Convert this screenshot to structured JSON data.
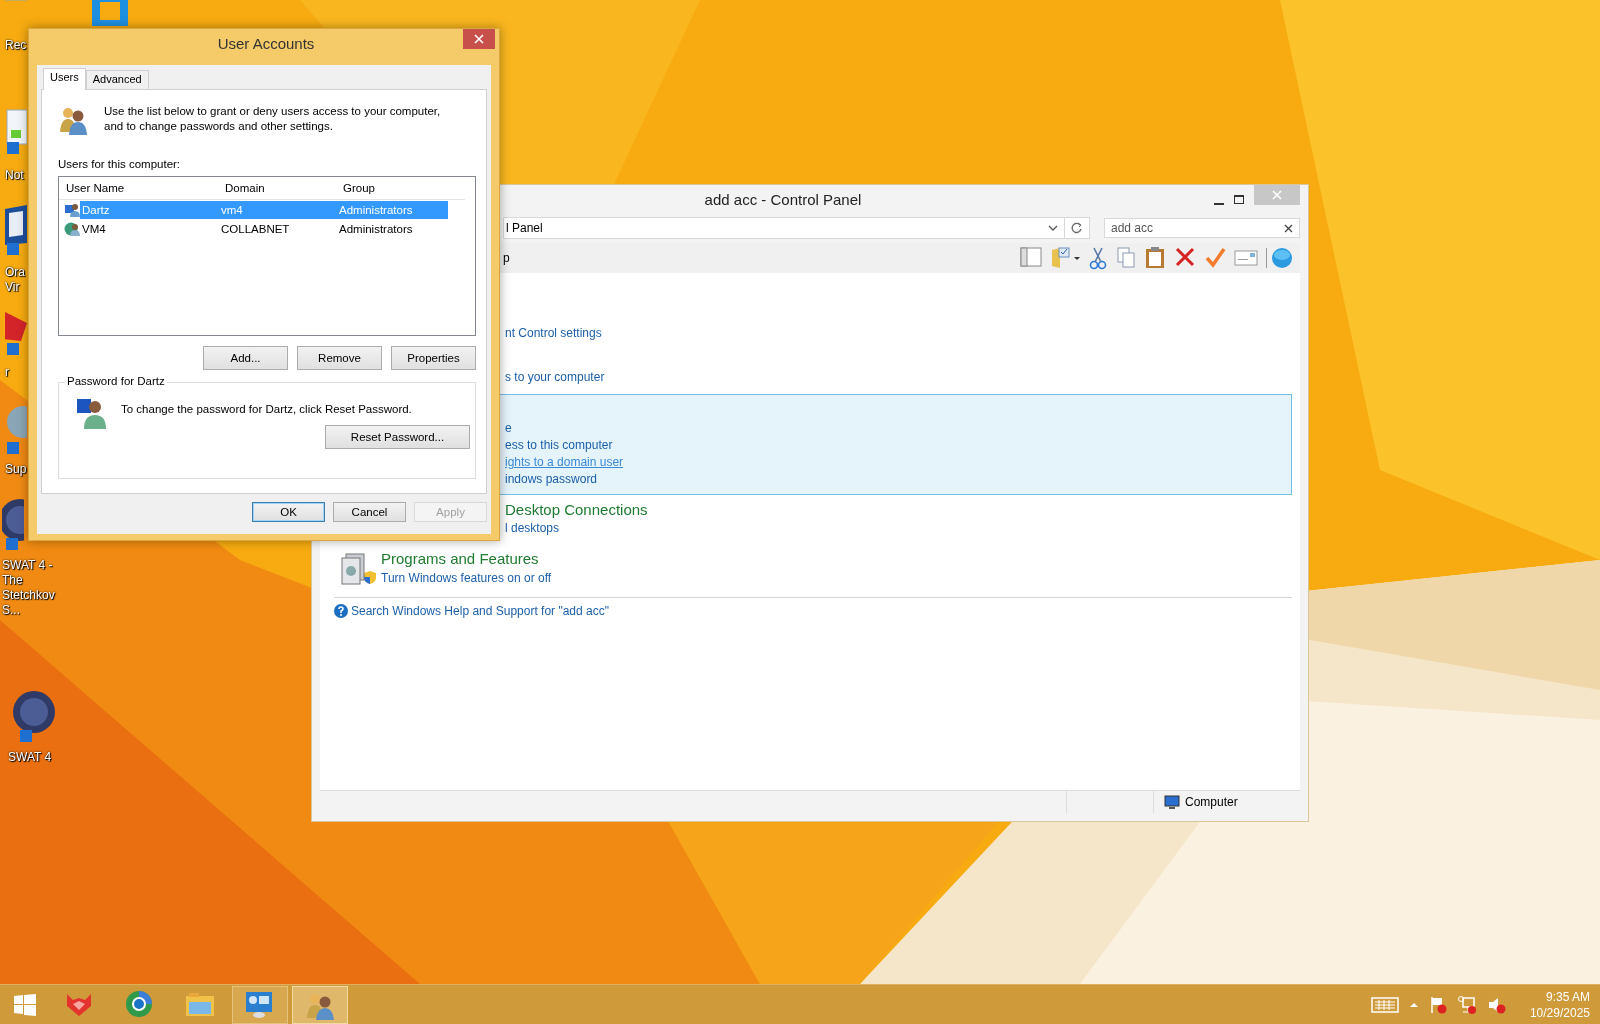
{
  "desktop": {
    "icons": [
      {
        "kind": "bin",
        "label": "Rec"
      },
      {
        "kind": "blue"
      },
      {
        "kind": "doc",
        "label": "Not"
      },
      {
        "kind": "box",
        "label": "Ora Vir"
      },
      {
        "kind": "red",
        "label": "r"
      },
      {
        "kind": "globe",
        "label": "Sup"
      },
      {
        "kind": "game",
        "label": "SWAT 4 - The Stetchkov S..."
      },
      {
        "kind": "game",
        "label": "SWAT 4"
      }
    ]
  },
  "control_panel": {
    "title": "add acc - Control Panel",
    "address": "l Panel",
    "search": "add acc",
    "toolbar_label": "p",
    "groups": [
      {
        "clipped": true,
        "highlighted": false,
        "links": [
          {
            "text": "nt Control settings",
            "hover": false
          }
        ]
      },
      {
        "clipped": true,
        "highlighted": false,
        "links": [
          {
            "text": "s to your computer",
            "hover": false
          }
        ]
      },
      {
        "clipped": true,
        "highlighted": true,
        "links": [
          {
            "text": "e",
            "hover": false
          },
          {
            "text": "ess to this computer",
            "hover": false
          },
          {
            "text": "ights to a domain user",
            "hover": true
          },
          {
            "text": "indows password",
            "hover": false
          }
        ]
      },
      {
        "clipped": true,
        "highlighted": false,
        "title": "Desktop Connections",
        "links": [
          {
            "text": "l desktops",
            "hover": false
          }
        ]
      },
      {
        "clipped": false,
        "highlighted": false,
        "title": "Programs and Features",
        "links": [
          {
            "text": "Turn Windows features on or off",
            "hover": false
          }
        ]
      }
    ],
    "help_link": "Search Windows Help and Support for \"add acc\"",
    "status": "Computer"
  },
  "dialog": {
    "title": "User Accounts",
    "tabs": [
      {
        "label": "Users",
        "selected": true
      },
      {
        "label": "Advanced",
        "selected": false
      }
    ],
    "intro": "Use the list below to grant or deny users access to your computer, and to change passwords and other settings.",
    "list_label": "Users for this computer:",
    "columns": [
      "User Name",
      "Domain",
      "Group"
    ],
    "rows": [
      {
        "cells": [
          "Dartz",
          "vm4",
          "Administrators"
        ],
        "selected": true
      },
      {
        "cells": [
          "VM4",
          "COLLABNET",
          "Administrators"
        ],
        "selected": false
      }
    ],
    "list_buttons": [
      "Add...",
      "Remove",
      "Properties"
    ],
    "password_group": {
      "title": "Password for Dartz",
      "text": "To change the password for Dartz, click Reset Password.",
      "button": "Reset Password..."
    },
    "buttons": [
      {
        "label": "OK",
        "default": true,
        "disabled": false
      },
      {
        "label": "Cancel",
        "default": false,
        "disabled": false
      },
      {
        "label": "Apply",
        "default": false,
        "disabled": true
      }
    ]
  },
  "taskbar": {
    "items": [
      {
        "kind": "fox",
        "running": false,
        "selected": false
      },
      {
        "kind": "browser",
        "running": false,
        "selected": false
      },
      {
        "kind": "folder",
        "running": false,
        "selected": false
      },
      {
        "kind": "panel",
        "running": true,
        "selected": false
      },
      {
        "kind": "users",
        "running": true,
        "selected": true
      }
    ],
    "time": "9:35 AM",
    "date": "10/29/2025"
  }
}
